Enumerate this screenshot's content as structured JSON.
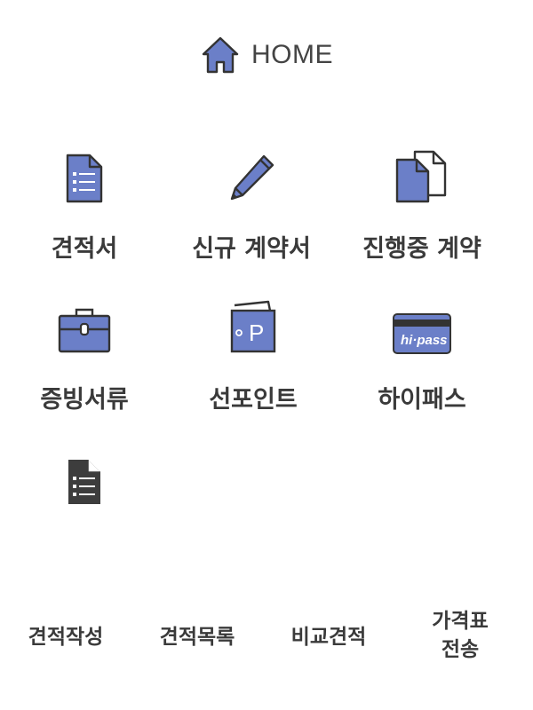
{
  "header": {
    "title": "HOME",
    "icon": "home-icon"
  },
  "tiles": [
    {
      "label": "견적서",
      "icon": "document-list-icon"
    },
    {
      "label": "신규 계약서",
      "icon": "pencil-icon"
    },
    {
      "label": "진행중 계약",
      "icon": "documents-copy-icon"
    },
    {
      "label": "증빙서류",
      "icon": "briefcase-icon"
    },
    {
      "label": "선포인트",
      "icon": "point-wallet-icon"
    },
    {
      "label": "하이패스",
      "icon": "hipass-card-icon",
      "card_text": "hi·pass"
    },
    {
      "label": "",
      "icon": "document-list-dark-icon"
    }
  ],
  "bottom_nav": [
    {
      "label": "견적작성"
    },
    {
      "label": "견적목록"
    },
    {
      "label": "비교견적"
    },
    {
      "label_line1": "가격표",
      "label_line2": "전송"
    }
  ],
  "colors": {
    "accent": "#6b7fc8",
    "stroke": "#333333",
    "text": "#3a3a3a",
    "dark_icon": "#3d3d3d"
  }
}
